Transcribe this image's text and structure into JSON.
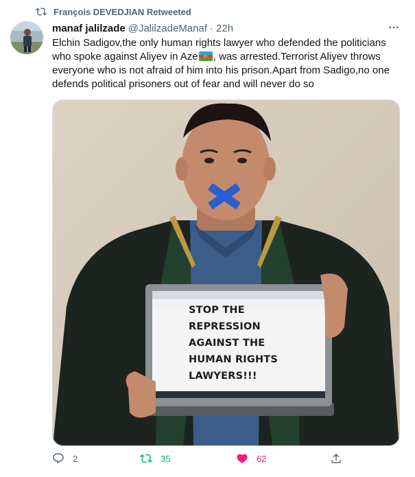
{
  "social_context": {
    "text": "François DEVEDJIAN Retweeted"
  },
  "tweet": {
    "display_name": "manaf jalilzade",
    "handle": "@JalilzadeManaf",
    "separator": "·",
    "time": "22h",
    "text_before_flag": "Elchin Sadigov,the only human rights lawyer who defended the politicians who spoke against Aliyev in Aze",
    "text_after_flag": ", was arrested.Terrorist Aliyev throws everyone who is not afraid of him into his prison.Apart from Sadigo,no one defends political prisoners out of fear and will never do so",
    "flag_emoji": "azerbaijan-flag",
    "image_sign_lines": [
      "STOP THE",
      "REPRESSION",
      "AGAINST THE",
      "HUMAN RIGHTS",
      "LAWYERS!!!"
    ]
  },
  "actions": {
    "reply_count": "2",
    "retweet_count": "35",
    "like_count": "62"
  },
  "colors": {
    "retweet_green": "#00ba7c",
    "like_pink": "#f91880",
    "secondary_gray": "#536471",
    "flag_blue": "#00b5e2",
    "flag_red": "#ef3340",
    "flag_green": "#509e2f"
  }
}
